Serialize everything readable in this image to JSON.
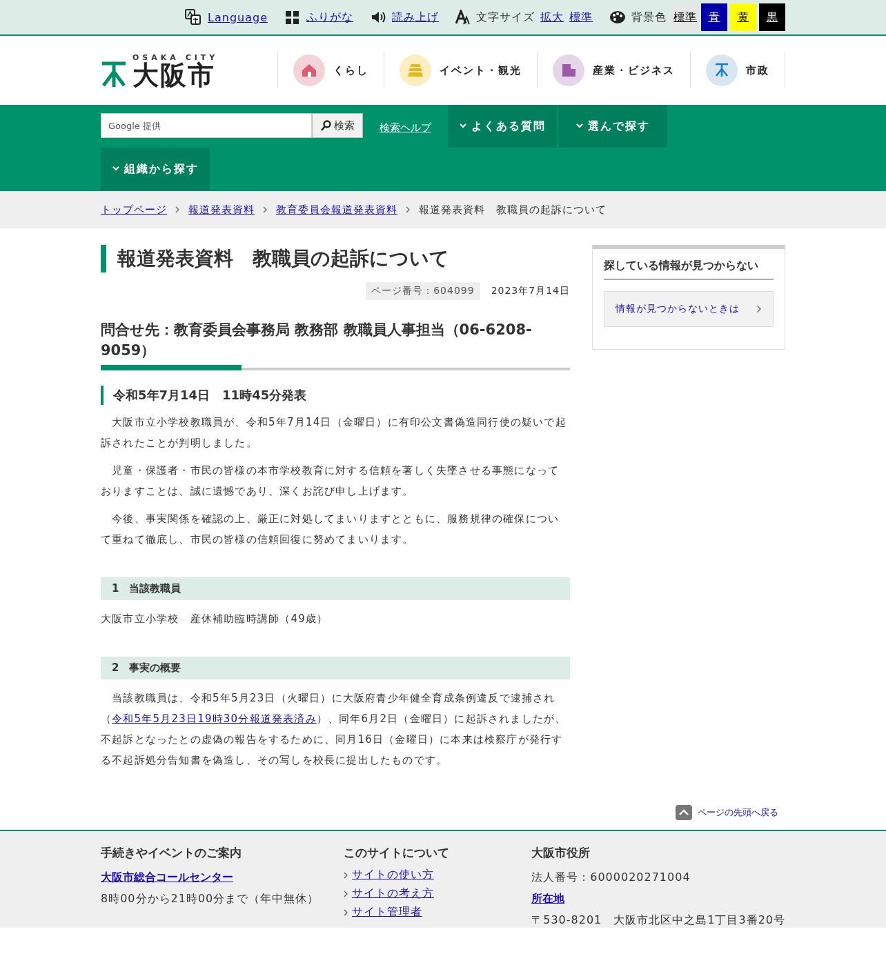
{
  "top_bar": {
    "links": [
      {
        "kind": "language",
        "label": "Language"
      },
      {
        "kind": "furigana",
        "label": "ふりがな"
      },
      {
        "kind": "speech",
        "label": "読み上げ"
      }
    ],
    "font_size": {
      "label": "文字サイズ",
      "options": [
        "拡大",
        "標準"
      ]
    },
    "background": {
      "label": "背景色",
      "options": [
        {
          "label": "標準",
          "color": "#e6e6e6"
        },
        {
          "label": "青",
          "color": "#0000aa"
        },
        {
          "label": "黄",
          "color": "#ffff00"
        },
        {
          "label": "黒",
          "color": "#000000"
        }
      ]
    }
  },
  "header": {
    "logo": {
      "subtitle": "OSAKA CITY",
      "title": "大阪市"
    },
    "nav": [
      {
        "label": "くらし",
        "color": "#f3d3d8"
      },
      {
        "label": "イベント・観光",
        "color": "#fdeec0"
      },
      {
        "label": "産業・ビジネス",
        "color": "#e6d5e8"
      },
      {
        "label": "市政",
        "color": "#d8e6f2"
      }
    ]
  },
  "green_nav": {
    "search": {
      "placeholder": "Google 提供",
      "button": "検索"
    },
    "help_link": "検索ヘルプ",
    "menus": [
      "よくある質問",
      "選んで探す",
      "組織から探す"
    ]
  },
  "breadcrumb": {
    "links": [
      "トップページ",
      "報道発表資料",
      "教育委員会報道発表資料"
    ],
    "current": "報道発表資料　教職員の起訴について"
  },
  "article": {
    "title": "報道発表資料　教職員の起訴について",
    "page_number": "ページ番号：604099",
    "date": "2023年7月14日",
    "contact": "問合せ先：教育委員会事務局 教務部 教職員人事担当（06-6208-9059）",
    "announcement": "令和5年7月14日　11時45分発表",
    "paragraphs": [
      [
        {
          "text": "　大阪市立小学校教職員が、令和5年7月14日（金曜日）に有印公文書偽造同行使の疑いで起訴されたことが判明しました。"
        }
      ],
      [
        {
          "text": "　児童・保護者・市民の皆様の本市学校教育に対する信頼を著しく失墜させる事態になっておりますことは、誠に遺憾であり、深くお詫び申し上げます。"
        }
      ],
      [
        {
          "text": "　今後、事実関係を確認の上、厳正に対処してまいりますとともに、服務規律の確保について重ねて徹底し、市民の皆様の信頼回復に努めてまいります。"
        }
      ]
    ],
    "sections": [
      {
        "heading": "1　当該教職員",
        "paragraphs": [
          [
            {
              "text": "大阪市立小学校　産休補助臨時講師（49歳）"
            }
          ]
        ]
      },
      {
        "heading": "2　事実の概要",
        "paragraphs": [
          [
            {
              "text": "　当該教職員は、令和5年5月23日（火曜日）に大阪府青少年健全育成条例違反で逮捕され（"
            },
            {
              "link": "令和5年5月23日19時30分報道発表済み"
            },
            {
              "text": "）、同年6月2日（金曜日）に起訴されましたが、不起訴となったとの虚偽の報告をするために、同月16日（金曜日）に本来は検察庁が発行する不起訴処分告知書を偽造し、その写しを校長に提出したものです。"
            }
          ]
        ]
      }
    ]
  },
  "sidebar": {
    "heading": "探している情報が見つからない",
    "link": "情報が見つからないときは"
  },
  "page_top": "ページの先頭へ戻る",
  "footer": {
    "columns": [
      {
        "heading": "手続きやイベントのご案内",
        "items": [
          {
            "kind": "bold_link",
            "text": "大阪市総合コールセンター"
          },
          {
            "kind": "text",
            "text": "8時00分から21時00分まで（年中無休）"
          }
        ]
      },
      {
        "heading": "このサイトについて",
        "items": [
          {
            "kind": "list_link",
            "text": "サイトの使い方"
          },
          {
            "kind": "list_link",
            "text": "サイトの考え方"
          },
          {
            "kind": "list_link",
            "text": "サイト管理者"
          }
        ]
      },
      {
        "heading": "大阪市役所",
        "items": [
          {
            "kind": "text",
            "text": "法人番号：6000020271004"
          },
          {
            "kind": "bold_link",
            "text": "所在地"
          },
          {
            "kind": "text",
            "text": "〒530-8201　大阪市北区中之島1丁目3番20号"
          }
        ]
      }
    ]
  }
}
